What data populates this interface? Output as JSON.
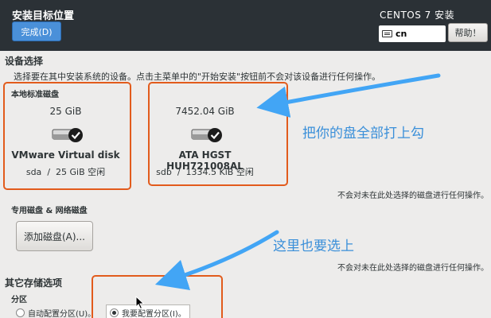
{
  "header": {
    "title": "安装目标位置",
    "done_button": "完成(D)",
    "product": "CENTOS 7 安装",
    "keyboard_layout": "cn",
    "help_button": "帮助！"
  },
  "device_selection": {
    "title": "设备选择",
    "description": "选择要在其中安装系统的设备。点击主菜单中的\"开始安装\"按钮前不会对该设备进行任何操作。",
    "local_title": "本地标准磁盘",
    "disks": [
      {
        "size": "25 GiB",
        "name": "VMware Virtual disk",
        "dev": "sda",
        "sep": "/",
        "free": "25 GiB 空闲",
        "selected": true
      },
      {
        "size": "7452.04 GiB",
        "name": "ATA HGST HUH721008AL",
        "dev": "sdb",
        "sep": "/",
        "free": "1334.5 KiB 空闲",
        "selected": true
      }
    ],
    "local_note": "不会对未在此处选择的磁盘进行任何操作。",
    "specialized_title": "专用磁盘 & 网络磁盘",
    "add_disk_button": "添加磁盘(A)...",
    "specialized_note": "不会对未在此处选择的磁盘进行任何操作。"
  },
  "other_options": {
    "title": "其它存储选项",
    "partition_title": "分区",
    "auto_option": "自动配置分区(U)。",
    "manual_option": "我要配置分区(I)。",
    "selected": "manual"
  },
  "annotations": {
    "callout_1": "把你的盘全部打上勾",
    "callout_2": "这里也要选上",
    "arrow_color": "#42a5f5",
    "box_color": "#e25b1c"
  }
}
